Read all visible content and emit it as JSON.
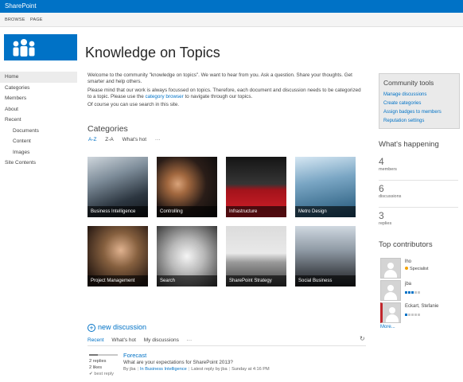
{
  "suitebar": {
    "brand": "SharePoint",
    "brand_color": "#0072c6"
  },
  "ribbon": {
    "tabs": [
      "BROWSE",
      "PAGE"
    ]
  },
  "site": {
    "logo_icon": "community-people-icon",
    "title": "Knowledge on Topics"
  },
  "quick_launch": [
    {
      "label": "Home",
      "selected": true
    },
    {
      "label": "Categories"
    },
    {
      "label": "Members"
    },
    {
      "label": "About"
    },
    {
      "label": "Recent"
    },
    {
      "label": "Documents",
      "sub": true
    },
    {
      "label": "Content",
      "sub": true
    },
    {
      "label": "Images",
      "sub": true
    },
    {
      "label": "Site Contents"
    }
  ],
  "intro": {
    "p1": "Welcome to the community \"knowledge on topics\". We want to hear from you. Ask a question. Share your thoughts. Get smarter and help others.",
    "p2_before": "Please mind that our work is always focussed on topics. Therefore, each document and discussion needs to be categorized to a topic. Please use the ",
    "p2_link": "category browser",
    "p2_after": " to navigate through our topics.",
    "p3": "Of course you can use search in this site."
  },
  "categories": {
    "heading": "Categories",
    "sort_options": [
      "A-Z",
      "Z-A",
      "What's hot",
      "···"
    ],
    "tiles": [
      "Business Intelligence",
      "Controlling",
      "Infrastructure",
      "Metro Design",
      "Project Management",
      "Search",
      "SharePoint Strategy",
      "Social Business"
    ]
  },
  "discussions": {
    "new_label": "new discussion",
    "tabs": [
      "Recent",
      "What's hot",
      "My discussions",
      "···"
    ],
    "items": [
      {
        "title": "Forecast",
        "question": "What are your expectations for SharePoint 2013?",
        "replies": "2 replies",
        "likes": "2 likes",
        "best_reply": "best reply",
        "by": "By jba",
        "category": "In Business Intelligence",
        "latest": "Latest reply by jba",
        "time": "Sunday at 4:16 PM"
      }
    ]
  },
  "community_tools": {
    "title": "Community tools",
    "links": [
      "Manage discussions",
      "Create categories",
      "Assign badges to members",
      "Reputation settings"
    ]
  },
  "whats_happening": {
    "title": "What's happening",
    "stats": [
      {
        "value": "4",
        "label": "members"
      },
      {
        "value": "6",
        "label": "discussions"
      },
      {
        "value": "3",
        "label": "replies"
      }
    ]
  },
  "top_contributors": {
    "title": "Top contributors",
    "people": [
      {
        "name": "lho",
        "badge": "Specialist",
        "level": null
      },
      {
        "name": "jba",
        "badge": null,
        "level": 3
      },
      {
        "name": "Eckart, Stefanie",
        "badge": null,
        "level": 1
      }
    ],
    "more": "More..."
  }
}
